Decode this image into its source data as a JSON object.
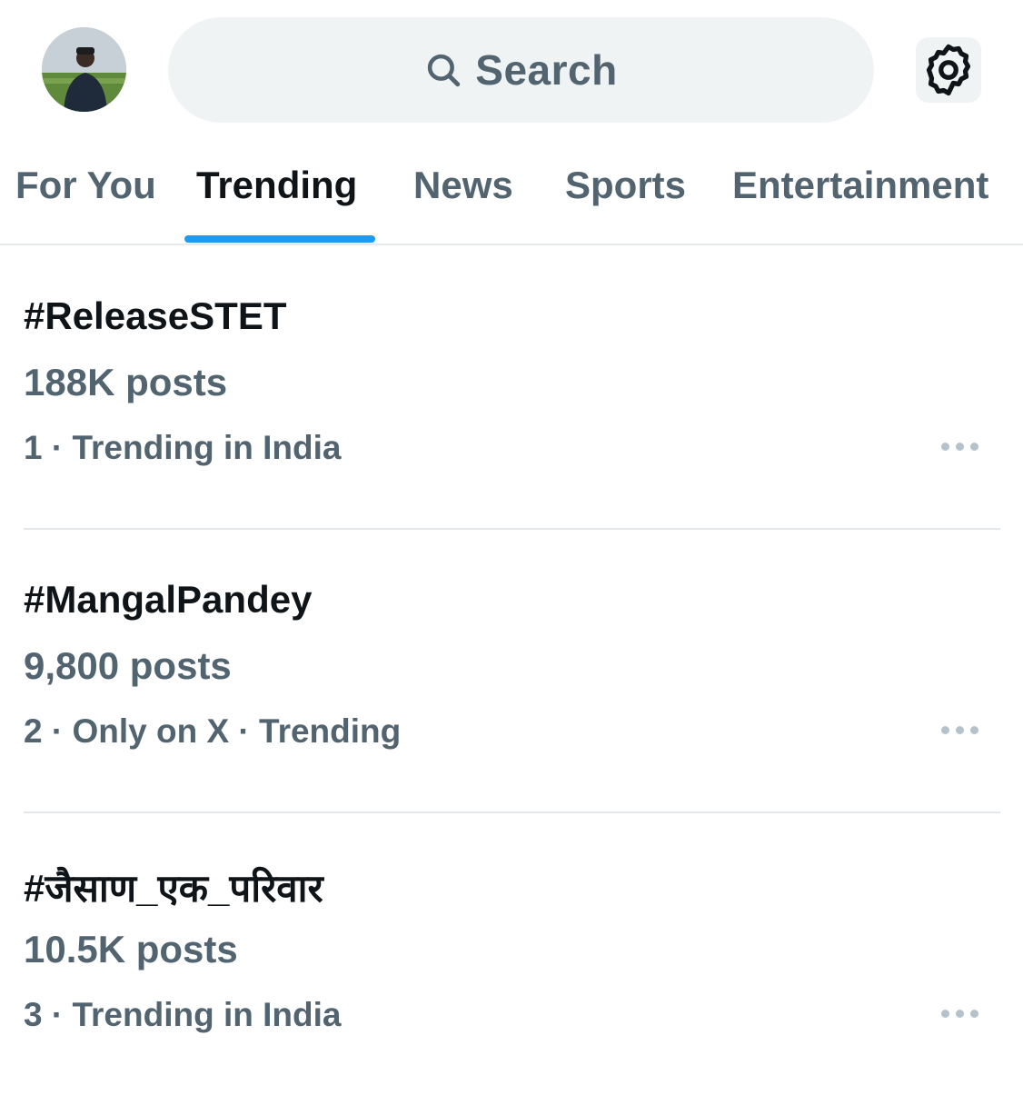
{
  "header": {
    "search_label": "Search",
    "search_icon": "search-icon",
    "settings_icon": "gear-icon",
    "avatar": "profile-avatar"
  },
  "tabs": [
    {
      "label": "For You",
      "active": false
    },
    {
      "label": "Trending",
      "active": true
    },
    {
      "label": "News",
      "active": false
    },
    {
      "label": "Sports",
      "active": false
    },
    {
      "label": "Entertainment",
      "active": false
    }
  ],
  "trends": [
    {
      "title": "#ReleaseSTET",
      "posts": "188K posts",
      "meta": "1 · Trending in India"
    },
    {
      "title": "#MangalPandey",
      "posts": "9,800 posts",
      "meta": "2 · Only on X · Trending"
    },
    {
      "title": "#जैसाण_एक_परिवार",
      "posts": "10.5K posts",
      "meta": "3 · Trending in India"
    }
  ],
  "colors": {
    "accent": "#1d9bf0",
    "primary_text": "#0f1419",
    "secondary_text": "#536471",
    "search_bg": "#eff3f4"
  }
}
